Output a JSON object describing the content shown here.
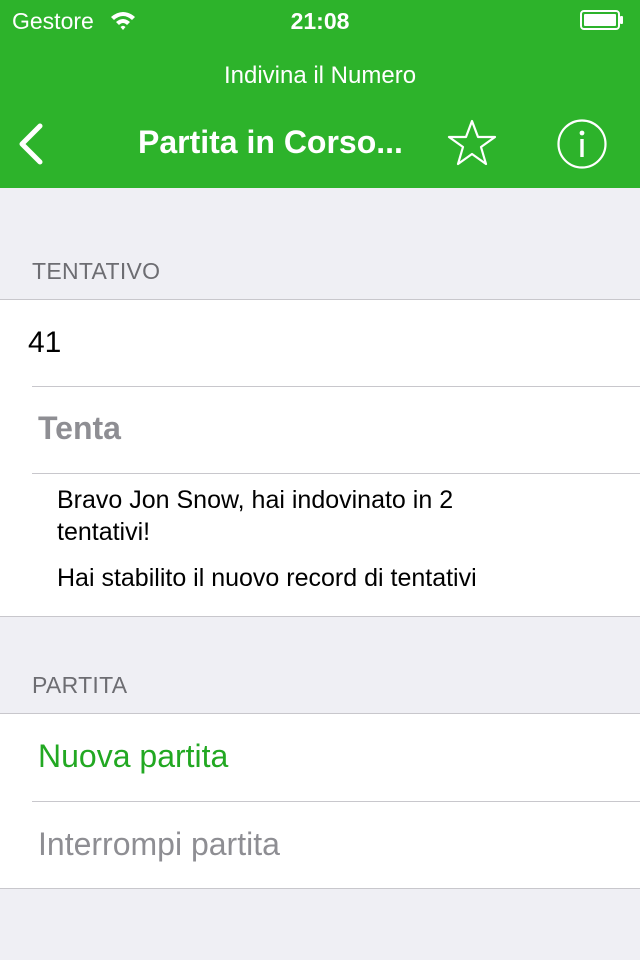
{
  "status_bar": {
    "carrier": "Gestore",
    "time": "21:08",
    "wifi_icon": "wifi-icon",
    "battery_icon": "battery-icon"
  },
  "header": {
    "app_title": "Indivina il Numero",
    "nav_title": "Partita in Corso...",
    "back_icon": "chevron-left-icon",
    "star_icon": "star-icon",
    "info_icon": "info-icon",
    "color": "#2db32b"
  },
  "attempt_section": {
    "header": "TENTATIVO",
    "guess_value": "41",
    "try_label": "Tenta",
    "message_line1": "Bravo Jon Snow, hai indovinato in 2",
    "message_line2": "tentativi!",
    "message_line3": "Hai stabilito il nuovo record di tentativi"
  },
  "game_section": {
    "header": "PARTITA",
    "new_game_label": "Nuova partita",
    "stop_game_label": "Interrompi partita"
  }
}
